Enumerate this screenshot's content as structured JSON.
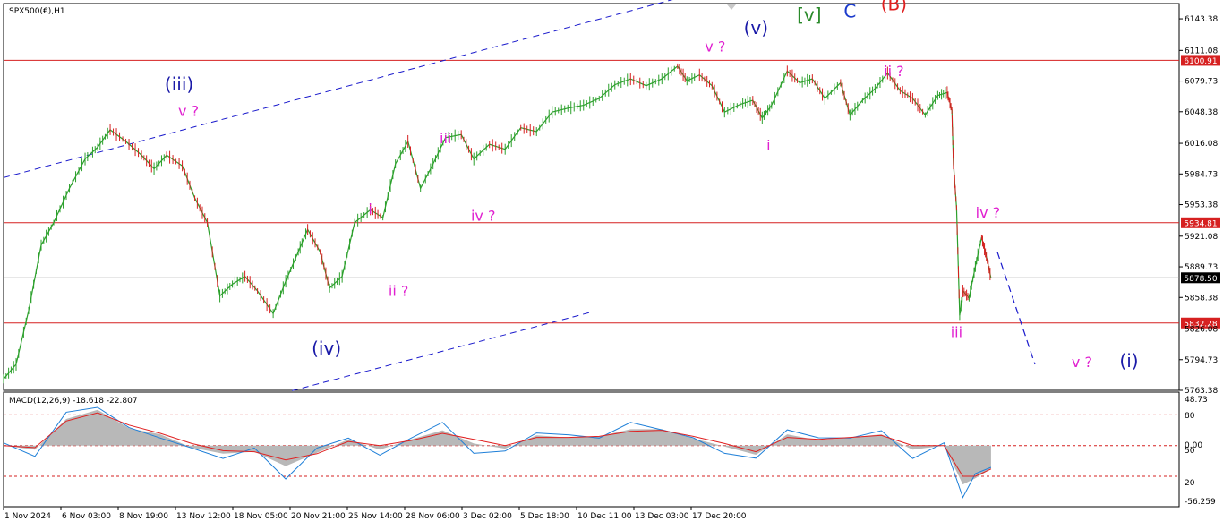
{
  "chart_data": [
    {
      "type": "line",
      "title": "SPX500(€),H1",
      "symbol": "SPX500(€)",
      "timeframe": "H1",
      "ylim": [
        5763.38,
        6160
      ],
      "y_ticks": [
        "6143.38",
        "6111.08",
        "6079.73",
        "6048.38",
        "6016.08",
        "5984.73",
        "5953.38",
        "5921.08",
        "5889.73",
        "5858.38",
        "5826.08",
        "5794.73",
        "5763.38"
      ],
      "price_levels": [
        {
          "label": "6100.91",
          "value": 6100.91,
          "color": "#d62020"
        },
        {
          "label": "5934.81",
          "value": 5934.81,
          "color": "#d62020"
        },
        {
          "label": "5832.28",
          "value": 5832.28,
          "color": "#d62020"
        },
        {
          "label": "5878.50",
          "value": 5878.5,
          "color": "#000000"
        }
      ],
      "x_ticks": [
        "1 Nov 2024",
        "6 Nov 03:00",
        "8 Nov 19:00",
        "13 Nov 12:00",
        "18 Nov 05:00",
        "20 Nov 21:00",
        "25 Nov 14:00",
        "28 Nov 06:00",
        "3 Dec 02:00",
        "5 Dec 18:00",
        "10 Dec 11:00",
        "13 Dec 03:00",
        "17 Dec 20:00"
      ],
      "series": [
        {
          "values": [
            {
              "t": 0,
              "v": 5775
            },
            {
              "t": 0.4,
              "v": 5790
            },
            {
              "t": 0.8,
              "v": 5845
            },
            {
              "t": 1.2,
              "v": 5912
            },
            {
              "t": 1.6,
              "v": 5935
            },
            {
              "t": 2.1,
              "v": 5970
            },
            {
              "t": 2.6,
              "v": 6000
            },
            {
              "t": 3.0,
              "v": 6012
            },
            {
              "t": 3.4,
              "v": 6030
            },
            {
              "t": 3.9,
              "v": 6018
            },
            {
              "t": 4.4,
              "v": 6004
            },
            {
              "t": 4.8,
              "v": 5990
            },
            {
              "t": 5.2,
              "v": 6004
            },
            {
              "t": 5.7,
              "v": 5993
            },
            {
              "t": 6.1,
              "v": 5960
            },
            {
              "t": 6.5,
              "v": 5935
            },
            {
              "t": 6.9,
              "v": 5860
            },
            {
              "t": 7.3,
              "v": 5872
            },
            {
              "t": 7.7,
              "v": 5880
            },
            {
              "t": 8.1,
              "v": 5865
            },
            {
              "t": 8.6,
              "v": 5842
            },
            {
              "t": 9.0,
              "v": 5875
            },
            {
              "t": 9.4,
              "v": 5905
            },
            {
              "t": 9.7,
              "v": 5928
            },
            {
              "t": 10.1,
              "v": 5905
            },
            {
              "t": 10.4,
              "v": 5868
            },
            {
              "t": 10.8,
              "v": 5880
            },
            {
              "t": 11.2,
              "v": 5935
            },
            {
              "t": 11.7,
              "v": 5948
            },
            {
              "t": 12.1,
              "v": 5940
            },
            {
              "t": 12.5,
              "v": 5995
            },
            {
              "t": 12.9,
              "v": 6018
            },
            {
              "t": 13.3,
              "v": 5970
            },
            {
              "t": 13.7,
              "v": 5995
            },
            {
              "t": 14.1,
              "v": 6022
            },
            {
              "t": 14.6,
              "v": 6025
            },
            {
              "t": 15.0,
              "v": 6000
            },
            {
              "t": 15.5,
              "v": 6015
            },
            {
              "t": 16.0,
              "v": 6010
            },
            {
              "t": 16.5,
              "v": 6032
            },
            {
              "t": 17.0,
              "v": 6028
            },
            {
              "t": 17.5,
              "v": 6048
            },
            {
              "t": 18.0,
              "v": 6052
            },
            {
              "t": 18.5,
              "v": 6055
            },
            {
              "t": 19.0,
              "v": 6062
            },
            {
              "t": 19.5,
              "v": 6076
            },
            {
              "t": 20.0,
              "v": 6082
            },
            {
              "t": 20.5,
              "v": 6075
            },
            {
              "t": 21.0,
              "v": 6082
            },
            {
              "t": 21.5,
              "v": 6095
            },
            {
              "t": 21.8,
              "v": 6080
            },
            {
              "t": 22.2,
              "v": 6086
            },
            {
              "t": 22.6,
              "v": 6075
            },
            {
              "t": 23.0,
              "v": 6048
            },
            {
              "t": 23.5,
              "v": 6056
            },
            {
              "t": 23.9,
              "v": 6060
            },
            {
              "t": 24.2,
              "v": 6042
            },
            {
              "t": 24.5,
              "v": 6055
            },
            {
              "t": 25.0,
              "v": 6090
            },
            {
              "t": 25.4,
              "v": 6078
            },
            {
              "t": 25.8,
              "v": 6082
            },
            {
              "t": 26.2,
              "v": 6062
            },
            {
              "t": 26.7,
              "v": 6078
            },
            {
              "t": 27.0,
              "v": 6045
            },
            {
              "t": 27.4,
              "v": 6060
            },
            {
              "t": 27.8,
              "v": 6072
            },
            {
              "t": 28.2,
              "v": 6088
            },
            {
              "t": 28.6,
              "v": 6070
            },
            {
              "t": 29.0,
              "v": 6062
            },
            {
              "t": 29.4,
              "v": 6045
            },
            {
              "t": 29.8,
              "v": 6065
            },
            {
              "t": 30.1,
              "v": 6068
            },
            {
              "t": 30.25,
              "v": 6050
            },
            {
              "t": 30.3,
              "v": 5995
            },
            {
              "t": 30.4,
              "v": 5950
            },
            {
              "t": 30.5,
              "v": 5840
            },
            {
              "t": 30.6,
              "v": 5865
            },
            {
              "t": 30.8,
              "v": 5858
            },
            {
              "t": 31.0,
              "v": 5890
            },
            {
              "t": 31.2,
              "v": 5920
            },
            {
              "t": 31.35,
              "v": 5900
            },
            {
              "t": 31.5,
              "v": 5878
            }
          ]
        }
      ],
      "forecast_path": [
        {
          "t": 31.7,
          "v": 5905
        },
        {
          "t": 32.9,
          "v": 5790
        }
      ],
      "channel_lines": [
        {
          "points": [
            {
              "t": 0,
              "v": 5981
            },
            {
              "t": 24.5,
              "v": 6190
            }
          ]
        },
        {
          "points": [
            {
              "t": 9.2,
              "v": 5763
            },
            {
              "t": 18.7,
              "v": 5843
            }
          ]
        }
      ],
      "wave_labels": [
        {
          "text": "(iii)",
          "t": 5.6,
          "v": 6070,
          "color": "#1a1aa8"
        },
        {
          "text": "v ?",
          "t": 5.9,
          "v": 6044,
          "color": "#e020d0"
        },
        {
          "text": "i",
          "t": 11.7,
          "v": 5944,
          "color": "#e020d0"
        },
        {
          "text": "ii ?",
          "t": 12.6,
          "v": 5860,
          "color": "#e020d0"
        },
        {
          "text": "(iv)",
          "t": 10.3,
          "v": 5800,
          "color": "#1a1aa8"
        },
        {
          "text": "iii",
          "t": 14.1,
          "v": 6016,
          "color": "#e020d0"
        },
        {
          "text": "iv ?",
          "t": 15.3,
          "v": 5937,
          "color": "#e020d0"
        },
        {
          "text": "v ?",
          "t": 22.7,
          "v": 6110,
          "color": "#e020d0"
        },
        {
          "text": "(v)",
          "t": 24.0,
          "v": 6128,
          "color": "#1a1aa8"
        },
        {
          "text": "[v]",
          "t": 25.7,
          "v": 6141,
          "color": "#2a8a2a"
        },
        {
          "text": "C",
          "t": 27.0,
          "v": 6145,
          "color": "#1a3acc"
        },
        {
          "text": "(B)",
          "t": 28.4,
          "v": 6152,
          "color": "#e02020"
        },
        {
          "text": "i",
          "t": 24.4,
          "v": 6009,
          "color": "#e020d0"
        },
        {
          "text": "ii ?",
          "t": 28.4,
          "v": 6085,
          "color": "#e020d0"
        },
        {
          "text": "iv ?",
          "t": 31.4,
          "v": 5940,
          "color": "#e020d0"
        },
        {
          "text": "iii",
          "t": 30.4,
          "v": 5818,
          "color": "#e020d0"
        },
        {
          "text": "v ?",
          "t": 34.4,
          "v": 5787,
          "color": "#e020d0"
        },
        {
          "text": "(i)",
          "t": 35.9,
          "v": 5787,
          "color": "#1a1aa8"
        }
      ]
    },
    {
      "type": "line",
      "title": "MACD(12,26,9) -18.618 -22.807",
      "indicator": "MACD(12,26,9)",
      "macd_value": "-18.618",
      "signal_value": "-22.807",
      "ylim": [
        -56.259,
        48.73
      ],
      "y_ticks": [
        "48.73",
        "80",
        "0.00",
        "50",
        "20",
        "-56.259"
      ],
      "levels": [
        30,
        0,
        -30
      ],
      "series": [
        {
          "name": "MACD",
          "color": "#1e7fd8",
          "kind": "line",
          "values": [
            {
              "t": 0,
              "v": 0
            },
            {
              "t": 1,
              "v": -8
            },
            {
              "t": 2,
              "v": 30
            },
            {
              "t": 3,
              "v": 40
            },
            {
              "t": 4,
              "v": 15
            },
            {
              "t": 5,
              "v": 10
            },
            {
              "t": 6,
              "v": -5
            },
            {
              "t": 7,
              "v": -10
            },
            {
              "t": 8,
              "v": -5
            },
            {
              "t": 9,
              "v": -30
            },
            {
              "t": 10,
              "v": -5
            },
            {
              "t": 11,
              "v": 10
            },
            {
              "t": 12,
              "v": -12
            },
            {
              "t": 13,
              "v": 10
            },
            {
              "t": 14,
              "v": 20
            },
            {
              "t": 15,
              "v": -5
            },
            {
              "t": 16,
              "v": -8
            },
            {
              "t": 17,
              "v": 15
            },
            {
              "t": 18,
              "v": 8
            },
            {
              "t": 19,
              "v": 10
            },
            {
              "t": 20,
              "v": 20
            },
            {
              "t": 21,
              "v": 18
            },
            {
              "t": 22,
              "v": 5
            },
            {
              "t": 23,
              "v": -5
            },
            {
              "t": 24,
              "v": -15
            },
            {
              "t": 25,
              "v": 18
            },
            {
              "t": 26,
              "v": 5
            },
            {
              "t": 27,
              "v": 10
            },
            {
              "t": 28,
              "v": 12
            },
            {
              "t": 29,
              "v": -10
            },
            {
              "t": 30,
              "v": 0
            },
            {
              "t": 30.6,
              "v": -48
            },
            {
              "t": 31,
              "v": -30
            },
            {
              "t": 31.5,
              "v": -18.6
            }
          ]
        },
        {
          "name": "Signal",
          "color": "#e02020",
          "kind": "line",
          "values": [
            {
              "t": 0,
              "v": 0
            },
            {
              "t": 1,
              "v": -2
            },
            {
              "t": 2,
              "v": 24
            },
            {
              "t": 3,
              "v": 32
            },
            {
              "t": 4,
              "v": 20
            },
            {
              "t": 5,
              "v": 12
            },
            {
              "t": 6,
              "v": 2
            },
            {
              "t": 7,
              "v": -5
            },
            {
              "t": 8,
              "v": -6
            },
            {
              "t": 9,
              "v": -14
            },
            {
              "t": 10,
              "v": -8
            },
            {
              "t": 11,
              "v": 4
            },
            {
              "t": 12,
              "v": 0
            },
            {
              "t": 13,
              "v": 5
            },
            {
              "t": 14,
              "v": 12
            },
            {
              "t": 15,
              "v": 6
            },
            {
              "t": 16,
              "v": 0
            },
            {
              "t": 17,
              "v": 8
            },
            {
              "t": 18,
              "v": 8
            },
            {
              "t": 19,
              "v": 9
            },
            {
              "t": 20,
              "v": 14
            },
            {
              "t": 21,
              "v": 15
            },
            {
              "t": 22,
              "v": 9
            },
            {
              "t": 23,
              "v": 2
            },
            {
              "t": 24,
              "v": -6
            },
            {
              "t": 25,
              "v": 8
            },
            {
              "t": 26,
              "v": 6
            },
            {
              "t": 27,
              "v": 8
            },
            {
              "t": 28,
              "v": 10
            },
            {
              "t": 29,
              "v": 0
            },
            {
              "t": 30,
              "v": 0
            },
            {
              "t": 30.6,
              "v": -30
            },
            {
              "t": 31,
              "v": -30
            },
            {
              "t": 31.5,
              "v": -22.8
            }
          ]
        },
        {
          "name": "Histogram",
          "color": "#b8b8b8",
          "kind": "area",
          "values": [
            {
              "t": 0,
              "v": 0
            },
            {
              "t": 1,
              "v": -4
            },
            {
              "t": 2,
              "v": 26
            },
            {
              "t": 3,
              "v": 35
            },
            {
              "t": 4,
              "v": 17
            },
            {
              "t": 5,
              "v": 11
            },
            {
              "t": 6,
              "v": -2
            },
            {
              "t": 7,
              "v": -8
            },
            {
              "t": 8,
              "v": -6
            },
            {
              "t": 9,
              "v": -20
            },
            {
              "t": 10,
              "v": -7
            },
            {
              "t": 11,
              "v": 6
            },
            {
              "t": 12,
              "v": -4
            },
            {
              "t": 13,
              "v": 6
            },
            {
              "t": 14,
              "v": 15
            },
            {
              "t": 15,
              "v": 2
            },
            {
              "t": 16,
              "v": -3
            },
            {
              "t": 17,
              "v": 10
            },
            {
              "t": 18,
              "v": 8
            },
            {
              "t": 19,
              "v": 9
            },
            {
              "t": 20,
              "v": 16
            },
            {
              "t": 21,
              "v": 16
            },
            {
              "t": 22,
              "v": 7
            },
            {
              "t": 23,
              "v": -1
            },
            {
              "t": 24,
              "v": -9
            },
            {
              "t": 25,
              "v": 11
            },
            {
              "t": 26,
              "v": 5
            },
            {
              "t": 27,
              "v": 8
            },
            {
              "t": 28,
              "v": 11
            },
            {
              "t": 29,
              "v": -4
            },
            {
              "t": 30,
              "v": 0
            },
            {
              "t": 30.6,
              "v": -38
            },
            {
              "t": 31,
              "v": -32
            },
            {
              "t": 31.5,
              "v": -22.8
            }
          ]
        }
      ]
    }
  ]
}
